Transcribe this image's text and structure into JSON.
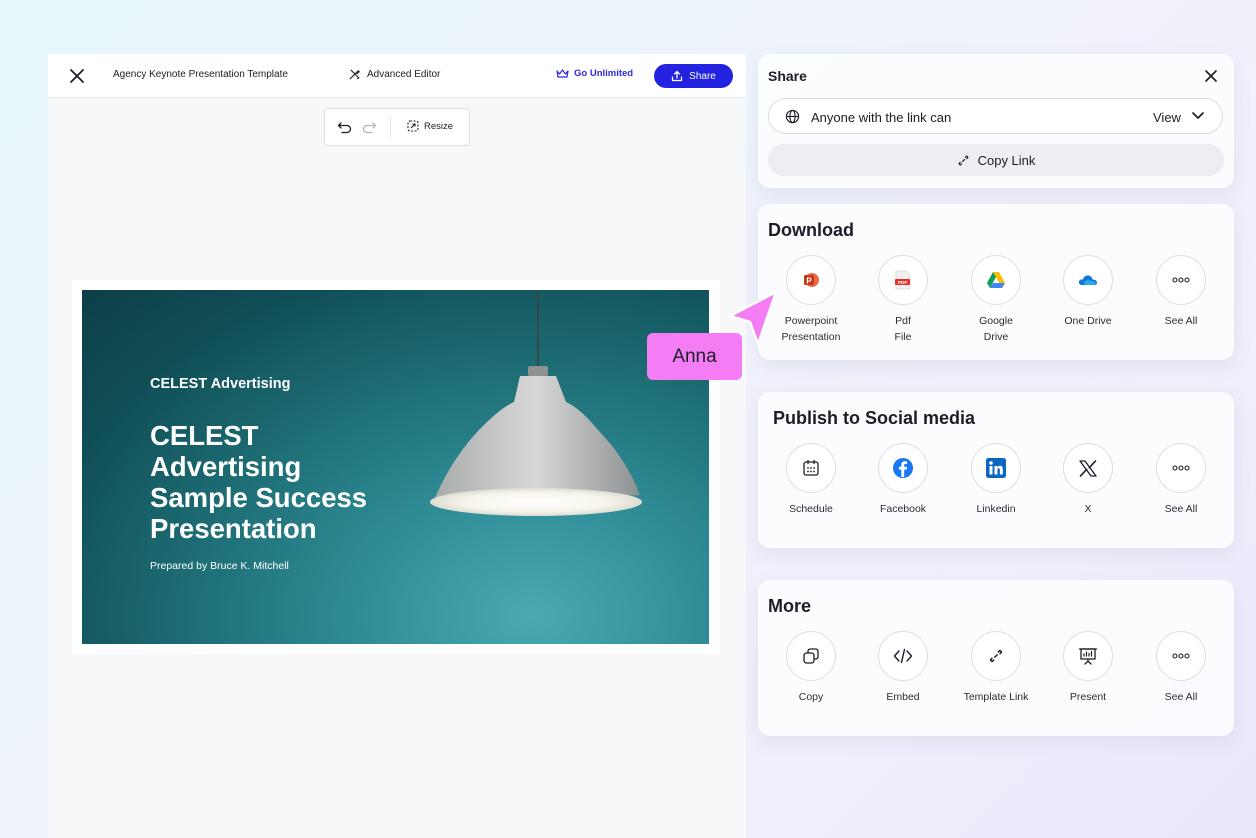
{
  "editor": {
    "doc_title": "Agency Keynote Presentation Template",
    "advanced_editor_label": "Advanced Editor",
    "go_unlimited_label": "Go Unlimited",
    "share_label": "Share",
    "resize_label": "Resize"
  },
  "slide": {
    "brand": "CELEST Advertising",
    "title_lines": [
      "CELEST",
      "Advertising",
      "Sample Success",
      "Presentation"
    ],
    "subtitle": "Prepared by Bruce K. Mitchell"
  },
  "share_panel": {
    "title": "Share",
    "access_text": "Anyone with the link can",
    "access_value": "View",
    "copy_link_label": "Copy Link"
  },
  "download_panel": {
    "title": "Download",
    "items": [
      {
        "icon": "powerpoint-icon",
        "line1": "Powerpoint",
        "line2": "Presentation"
      },
      {
        "icon": "pdf-icon",
        "line1": "Pdf",
        "line2": "File"
      },
      {
        "icon": "google-drive-icon",
        "line1": "Google",
        "line2": "Drive"
      },
      {
        "icon": "onedrive-icon",
        "line1": "One Drive",
        "line2": ""
      },
      {
        "icon": "more-icon",
        "line1": "See All",
        "line2": ""
      }
    ]
  },
  "social_panel": {
    "title": "Publish to Social media",
    "items": [
      {
        "icon": "calendar-icon",
        "label": "Schedule"
      },
      {
        "icon": "facebook-icon",
        "label": "Facebook"
      },
      {
        "icon": "linkedin-icon",
        "label": "Linkedin"
      },
      {
        "icon": "x-icon",
        "label": "X"
      },
      {
        "icon": "more-icon",
        "label": "See All"
      }
    ]
  },
  "more_panel": {
    "title": "More",
    "items": [
      {
        "icon": "copy-icon",
        "label": "Copy"
      },
      {
        "icon": "embed-icon",
        "label": "Embed"
      },
      {
        "icon": "link-icon",
        "label": "Template Link"
      },
      {
        "icon": "present-icon",
        "label": "Present"
      },
      {
        "icon": "more-icon",
        "label": "See All"
      }
    ]
  },
  "collaborator": {
    "name": "Anna",
    "color": "#f47cf4"
  },
  "colors": {
    "primary": "#2222e0",
    "slide_bg": "#1d6c74"
  }
}
